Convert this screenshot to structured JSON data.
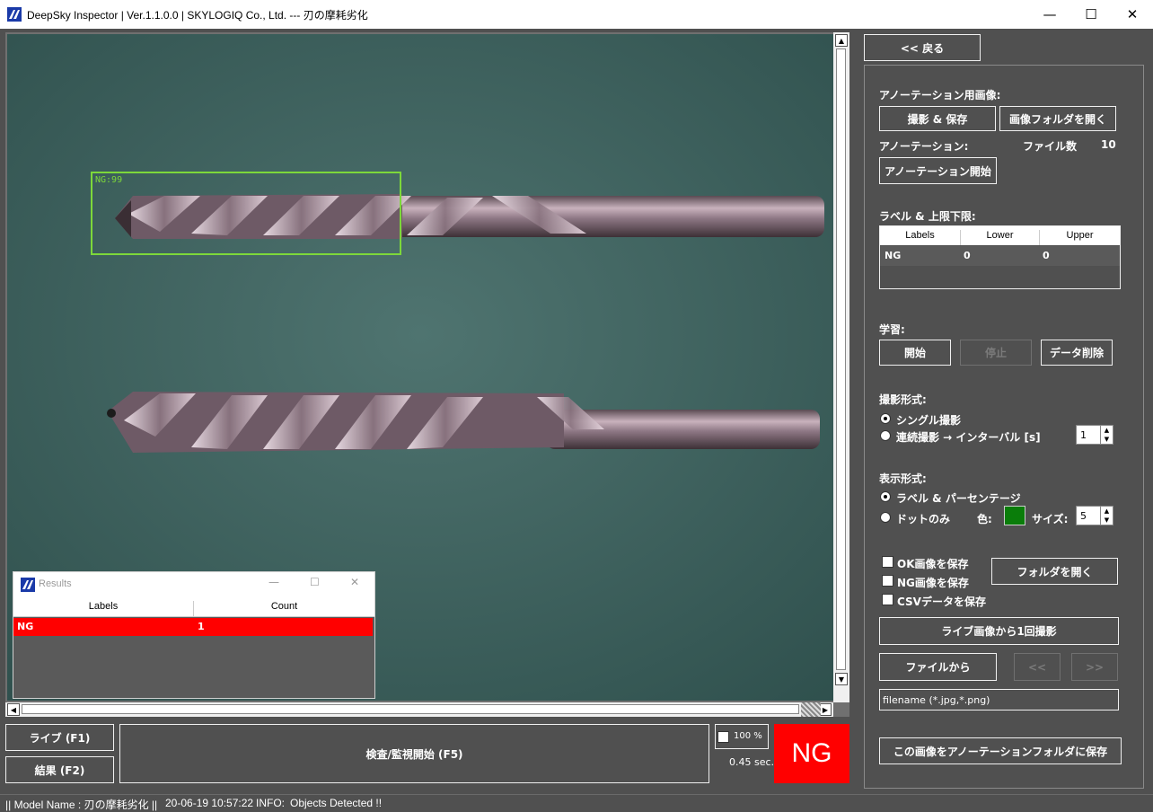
{
  "window": {
    "title": "DeepSky Inspector | Ver.1.1.0.0 | SKYLOGIQ Co., Ltd. --- 刃の摩耗劣化",
    "minimize": "—",
    "maximize": "☐",
    "close": "✕"
  },
  "viewer": {
    "detection": {
      "label": "NG:99",
      "color": "#7dd83a"
    }
  },
  "results_window": {
    "title": "Results",
    "col_labels": "Labels",
    "col_count": "Count",
    "rows": [
      {
        "label": "NG",
        "count": "1",
        "color": "#ff0000"
      }
    ]
  },
  "bottom_bar": {
    "live_button": "ライブ (F1)",
    "result_button": "結果 (F2)",
    "inspect_button": "検査/監視開始 (F5)",
    "zoom_label": "100 %",
    "elapsed": "0.45 sec.",
    "verdict": "NG",
    "verdict_color": "#ff0000"
  },
  "right_panel": {
    "back_button": "<< 戻る",
    "annotation_images_heading": "アノーテーション用画像:",
    "capture_save_button": "撮影 & 保存",
    "open_image_folder_button": "画像フォルダを開く",
    "annotation_heading": "アノーテーション:",
    "file_count_label": "ファイル数",
    "file_count_value": "10",
    "start_annotation_button": "アノーテーション開始",
    "label_limits_heading": "ラベル & 上限下限:",
    "label_table": {
      "headers": [
        "Labels",
        "Lower",
        "Upper"
      ],
      "rows": [
        {
          "label": "NG",
          "lower": "0",
          "upper": "0"
        }
      ]
    },
    "training_heading": "学習:",
    "train_start_button": "開始",
    "train_stop_button": "停止",
    "delete_data_button": "データ削除",
    "capture_mode_heading": "撮影形式:",
    "single_capture_label": "シングル撮影",
    "continuous_capture_label": "連続撮影 → インターバル [s]",
    "interval_value": "1",
    "display_mode_heading": "表示形式:",
    "label_percentage_label": "ラベル & パーセンテージ",
    "dot_only_label": "ドットのみ",
    "color_label": "色:",
    "color_value": "#0a7d0a",
    "size_label": "サイズ:",
    "size_value": "5",
    "save_ok_label": "OK画像を保存",
    "save_ng_label": "NG画像を保存",
    "save_csv_label": "CSVデータを保存",
    "open_folder_button": "フォルダを開く",
    "capture_from_live_button": "ライブ画像から1回撮影",
    "from_file_button": "ファイルから",
    "prev_button": "<<",
    "next_button": ">>",
    "filename_placeholder": "filename (*.jpg,*.png)",
    "save_to_annotation_button": "この画像をアノーテーションフォルダに保存"
  },
  "status_bar": {
    "model": "|| Model Name : 刃の摩耗劣化 ||",
    "timestamp": "20-06-19 10:57:22",
    "info_label": "INFO:",
    "info_text": "Objects Detected !!"
  }
}
